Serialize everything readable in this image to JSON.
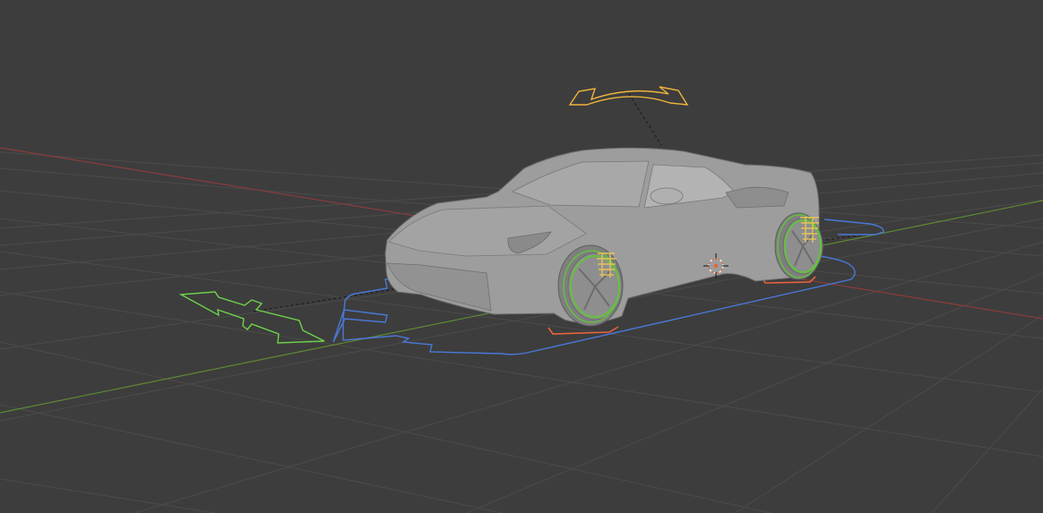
{
  "viewport": {
    "background": "#3d3d3d",
    "grid_color": "#4b4b4b",
    "x_axis_color": "#8b3b3b",
    "y_axis_color": "#5f8a32"
  },
  "scene": {
    "object": "sports-car-model",
    "car_color": "#9d9d9d",
    "controls": [
      {
        "name": "body-tilt-control",
        "color": "#f0b43c"
      },
      {
        "name": "move-arrows-control",
        "color": "#6ed24a"
      },
      {
        "name": "root-path-control",
        "color": "#4a78d8"
      },
      {
        "name": "wheel-controls",
        "color": "#63c23d"
      },
      {
        "name": "suspension-springs",
        "color": "#e5c25a"
      },
      {
        "name": "wheel-contact-markers",
        "color": "#e7643d"
      }
    ],
    "cursor": "3d-cursor-icon"
  }
}
